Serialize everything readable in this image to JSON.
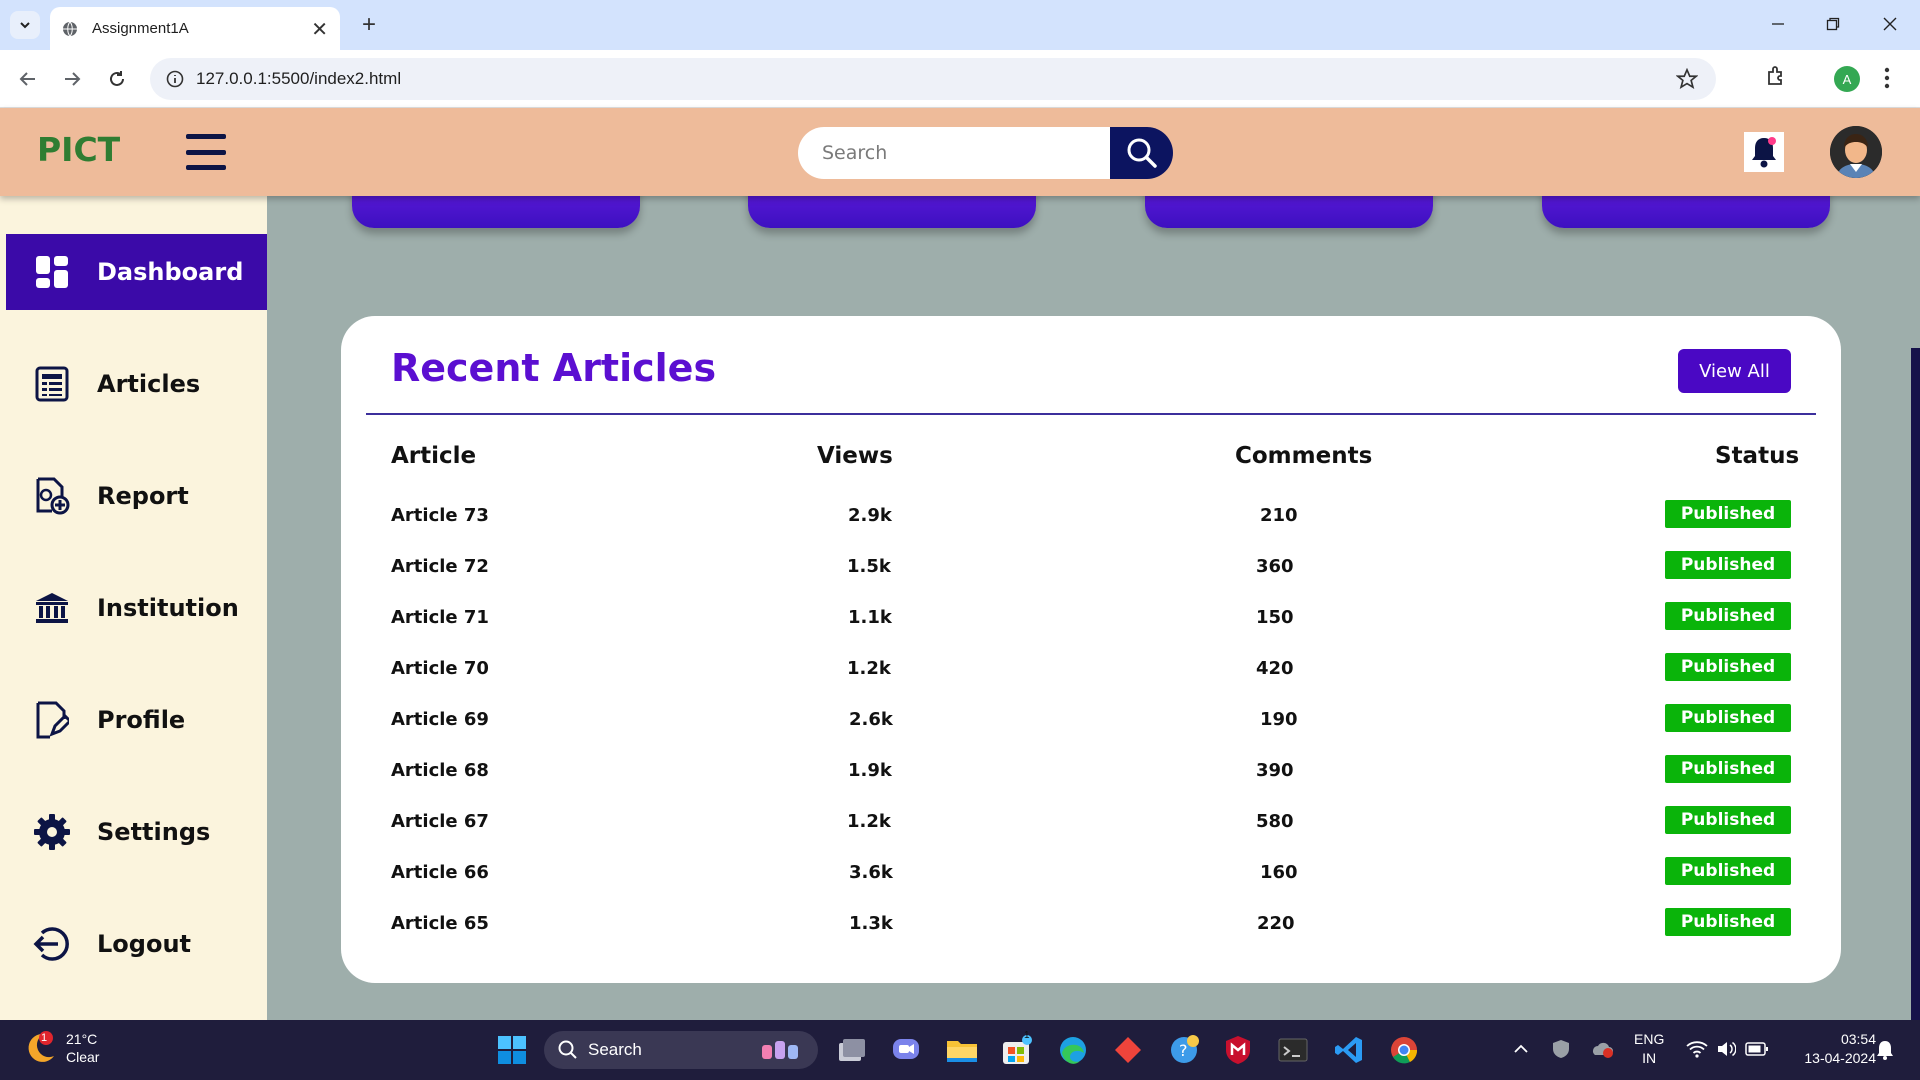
{
  "browser": {
    "tab_title": "Assignment1A",
    "url": "127.0.0.1:5500/index2.html",
    "profile_initial": "A"
  },
  "header": {
    "logo": "PICT",
    "search_placeholder": "Search"
  },
  "sidebar": {
    "items": [
      {
        "label": "Dashboard",
        "icon": "dashboard-icon",
        "active": true
      },
      {
        "label": "Articles",
        "icon": "articles-icon"
      },
      {
        "label": "Report",
        "icon": "report-icon"
      },
      {
        "label": "Institution",
        "icon": "institution-icon"
      },
      {
        "label": "Profile",
        "icon": "profile-icon"
      },
      {
        "label": "Settings",
        "icon": "settings-icon"
      },
      {
        "label": "Logout",
        "icon": "logout-icon"
      }
    ]
  },
  "recent_articles": {
    "title": "Recent Articles",
    "view_all": "View All",
    "columns": [
      "Article",
      "Views",
      "Comments",
      "Status"
    ],
    "rows": [
      {
        "article": "Article 73",
        "views": "2.9k",
        "comments": "210",
        "status": "Published"
      },
      {
        "article": "Article 72",
        "views": "1.5k",
        "comments": "360",
        "status": "Published"
      },
      {
        "article": "Article 71",
        "views": "1.1k",
        "comments": "150",
        "status": "Published"
      },
      {
        "article": "Article 70",
        "views": "1.2k",
        "comments": "420",
        "status": "Published"
      },
      {
        "article": "Article 69",
        "views": "2.6k",
        "comments": "190",
        "status": "Published"
      },
      {
        "article": "Article 68",
        "views": "1.9k",
        "comments": "390",
        "status": "Published"
      },
      {
        "article": "Article 67",
        "views": "1.2k",
        "comments": "580",
        "status": "Published"
      },
      {
        "article": "Article 66",
        "views": "3.6k",
        "comments": "160",
        "status": "Published"
      },
      {
        "article": "Article 65",
        "views": "1.3k",
        "comments": "220",
        "status": "Published"
      }
    ]
  },
  "taskbar": {
    "weather_temp": "21°C",
    "weather_desc": "Clear",
    "weather_badge": "1",
    "search_label": "Search",
    "store_badge": "1",
    "lang_line1": "ENG",
    "lang_line2": "IN",
    "time": "03:54",
    "date": "13-04-2024"
  },
  "colors": {
    "header_bg": "#eebb9a",
    "sidebar_bg": "#fbf4dd",
    "active_item": "#3b0aa8",
    "title_purple": "#5b0fd1",
    "badge_green": "#0ab40a",
    "main_bg": "#9eaeab"
  }
}
